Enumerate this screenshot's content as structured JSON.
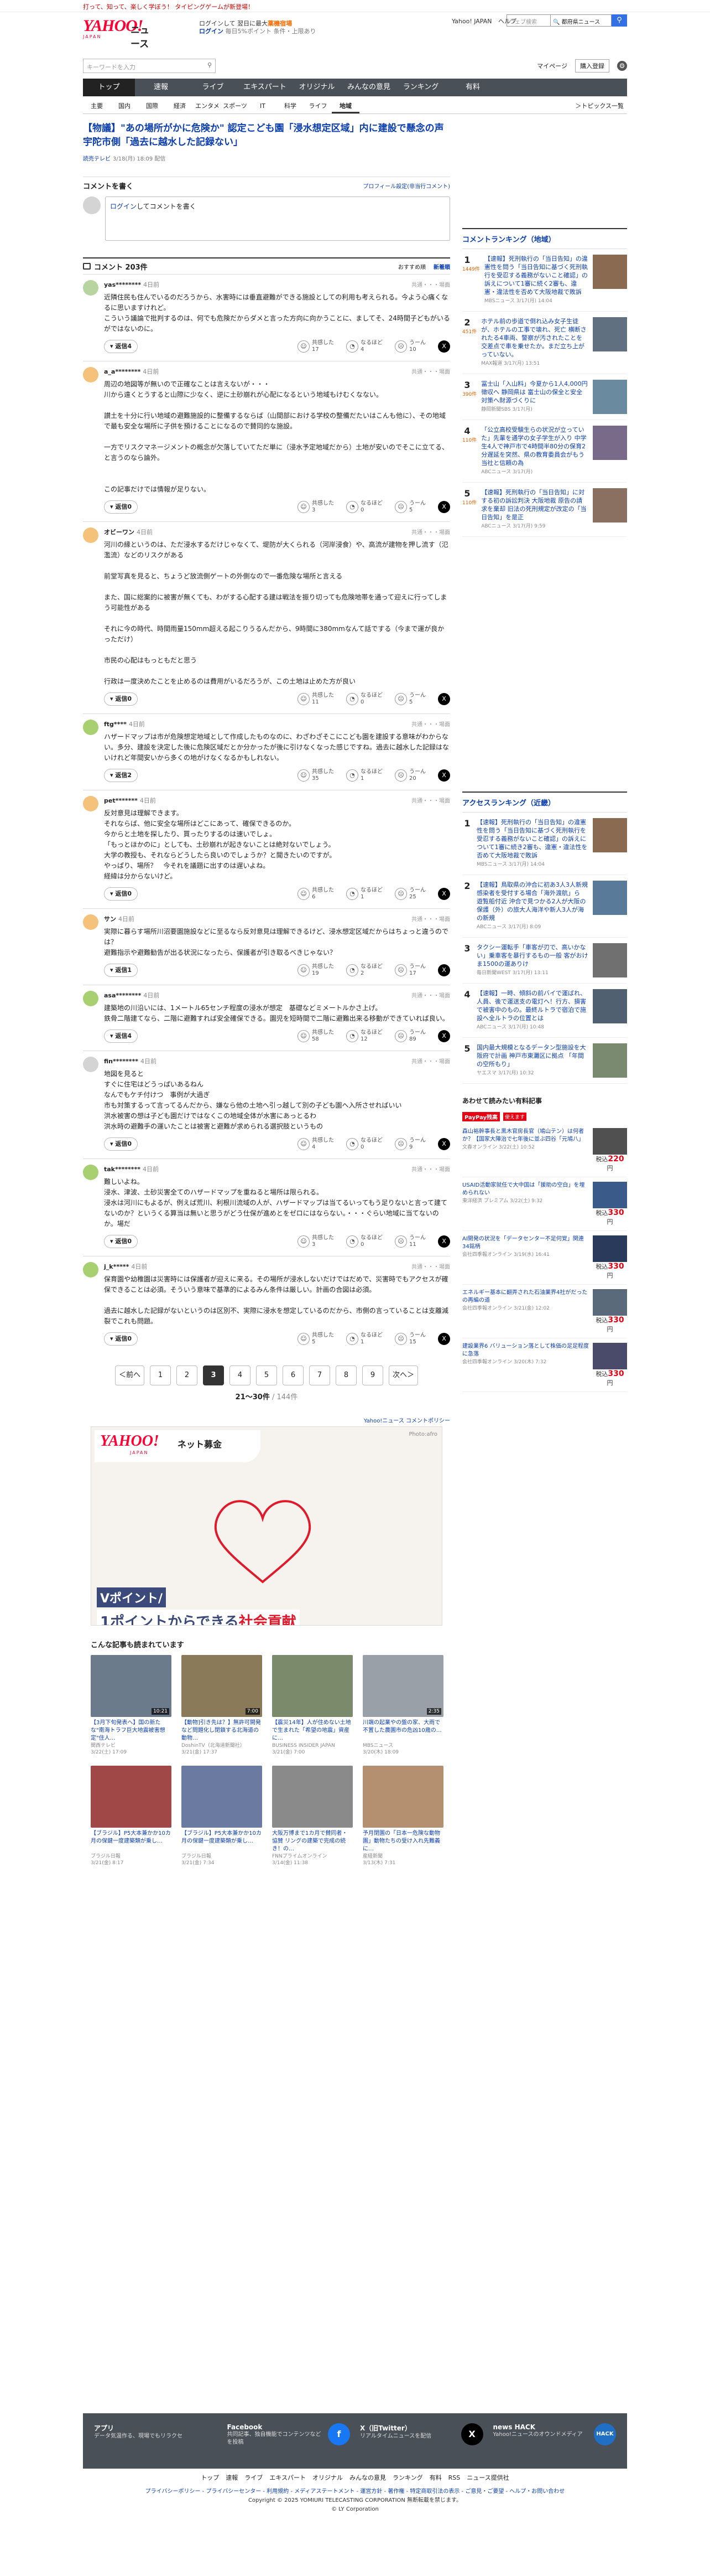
{
  "strip": "打って、知って、楽しく学ぼう！ タイピングゲームが新登場！",
  "header": {
    "logo_text": "YAHOO!",
    "logo_sub": "JAPAN",
    "section": "ニュース",
    "promo1_a": "ログインして",
    "promo1_b": "翌日に最大",
    "promo1_c": "薬機宿場",
    "promo2_a": "ログイン",
    "promo2_b": "毎日5%ポイント",
    "promo2_c": "条件・上限あり",
    "links": [
      "Yahoo! JAPAN",
      "ヘルプ"
    ],
    "search_placeholder": "ウェブ検索",
    "search_select": "🔍 都府県ニュース"
  },
  "keyword_search": {
    "placeholder": "キーワードを入力",
    "mypage": "マイページ",
    "register": "購入登録"
  },
  "global_nav": [
    "トップ",
    "速報",
    "ライブ",
    "エキスパート",
    "オリジナル",
    "みんなの意見",
    "ランキング",
    "有料"
  ],
  "sub_nav": [
    "主要",
    "国内",
    "国際",
    "経済",
    "エンタメ",
    "スポーツ",
    "IT",
    "科学",
    "ライフ",
    "地域"
  ],
  "sub_nav_more": "トピックス一覧",
  "article": {
    "title": "【物議】\"あの場所がかに危険か\" 認定こども園「浸水想定区域」内に建設で懸念の声　宇陀市側「過去に越水した記録ない」",
    "source": "読売テレビ",
    "time": "3/18(月) 18:09 配信"
  },
  "comment_write": {
    "heading": "コメントを書く",
    "profile": "プロフィール設定(非当行コメント)",
    "prompt_link": "ログイン",
    "prompt_rest": "してコメントを書く"
  },
  "comments_header": {
    "title": "コメント 203件",
    "sort1": "おすすめ順",
    "sort2": "新着順"
  },
  "reaction_labels": [
    "共感した",
    "なるほど",
    "うーん"
  ],
  "reply_label": "返信",
  "category": "共通・・・場面",
  "comments": [
    {
      "user": "yas********",
      "time": "4日前",
      "color": "#b8d4a0",
      "text": "近隣住民も住んでいるのだろうから、水害時には垂直避難ができる施設としての利用も考えられる。今よう心痛くなるに思いますけれど。\nこういう議論で批判するのは、何でも危険だからダメと言った方向に向かうことに、ましてそ、24時間子どもがいるがではないのに。",
      "replies": "4",
      "r": [
        "17",
        "4",
        "10"
      ]
    },
    {
      "user": "a_a********",
      "time": "4日前",
      "color": "#f4c27a",
      "text": "周辺の地図等が無いので正確なことは言えないが・・・\n川から遠くとうすると山際に少なく、逆に土砂崩れが心配になるという地域もけむくなない。\n\n讃土を十分に行い地域の避難施設的に整備するならば（山間部における学校の整備だたいはこんも他に）、その地域で最も安全な場所に子供を預けることになるので賛同的な施設。\n\n一方でリスクマネージメントの概念が欠落していてただ単に（浸水予定地域だから）土地が安いのでそこに立てる、と言うのなら論外。\n\n\nこの記事だけでは情報が足りない。",
      "replies": "0",
      "r": [
        "3",
        "0",
        "5"
      ]
    },
    {
      "user": "オビーワン",
      "time": "4日前",
      "color": "#f4c27a",
      "text": "河川の縁というのは、ただ浸水するだけじゃなくて、堤防が大くられる（河岸浸食）や、高流が建物を押し流す（氾濫流）などのリスクがある\n\n前堂写真を見ると、ちょうど放流側ゲートの外側なので一番危険な場所と言える\n\nまた、国に総案的に被害が無くても、わがする心配する建は戦法を振り切っても危険地帯を通って迎えに行ってしまう可能性がある\n\nそれに今の時代、時間雨量150mm超える起こりうるんだから、9時間に380mmなんて話でする（今まで運が良かっただけ）\n\n市民の心配はもっともだと思う\n\n行政は一度決めたことを止めるのは費用がいるだろうが、この土地は止めた方が良い",
      "replies": "0",
      "r": [
        "11",
        "0",
        "5"
      ]
    },
    {
      "user": "ftg****",
      "time": "4日前",
      "color": "#a8d070",
      "text": "ハザードマップは市が危険想定地域として作成したものなのに、わざわざそこにこども園を建設する意味がわからない。多分、建設を決定した後に危険区域だとか分かったが後に引けなくなった感じですね。過去に越水した記録はないけれど年間安いから多くの地がけなくなるかもしれない。",
      "replies": "2",
      "r": [
        "35",
        "1",
        "20"
      ]
    },
    {
      "user": "pet*******",
      "time": "4日前",
      "color": "#f4c27a",
      "text": "反対意見は理解できます。\nそれならば、他に安全な場所はどこにあって、確保できるのか。\n今からと土地を探したり、買ったりするのは速いでしょ。\n「もっとほかのに」としても、土砂崩れが起きないことは絶対ないでしょう。\n大学の教授も、それならどうしたら良いのでしょうか？と聞きたいのですが。\nやっぱり、場所？　今それを議題に出すのは遅いよね。\n経緯は分からないけど。",
      "replies": "0",
      "r": [
        "6",
        "1",
        "25"
      ]
    },
    {
      "user": "サン",
      "time": "4日前",
      "color": "#f4c27a",
      "text": "実際に暮らす場所川沼要園施設などに至るなら反対意見は理解できるけど、浸水想定区域だからはちょっと違うのでは？\n避難指示や避難勧告が出る状況になったら、保護者が引き取るべきじゃない？",
      "replies": "1",
      "r": [
        "19",
        "2",
        "17"
      ]
    },
    {
      "user": "asa********",
      "time": "4日前",
      "color": "#a8d070",
      "text": "建築地の川沿いには、1メートル65センチ程度の浸水が想定　基礎などミメートルかさ上げ。\n鉄骨二階建てなら、二階に避難すれば安全確保できる。園児を短時間で二階に避難出来る移動ができていれば良い。",
      "replies": "4",
      "r": [
        "58",
        "12",
        "89"
      ]
    },
    {
      "user": "fin********",
      "time": "4日前",
      "color": "#d4d4d4",
      "text": "地図を見ると\nすぐに住宅はどうっぱいあるねん\nなんでもケチ付けつ　事例が大過ぎ\n市も対策するって言ってるんだから、嫌なら他の土地へ引っ越して別の子ども園へ入所させればいい\n洪水被害の想は子ども園だけではなくこの地域全体が水害にあっとるわ\n洪水時の避難手の運いたことは被害と避難が求められる選択肢というもの",
      "replies": "0",
      "r": [
        "4",
        "0",
        "9"
      ]
    },
    {
      "user": "tak********",
      "time": "4日前",
      "color": "#a8d070",
      "text": "難しいよね。\n浸水、津波、土砂災害全てのハザードマップを重ねると場所は限られる。\n浸水は河川にもよるが、例えば荒川、利根川流域の人が、ハザードマップは当てるいってもう足りないと言って建てないのか？というくる算当は無いと思うがどう仕保が進めとをゼロにはならない。・・・ぐらい地域に当てないのか。場だ",
      "replies": "0",
      "r": [
        "3",
        "0",
        "11"
      ]
    },
    {
      "user": "j_k*****",
      "time": "4日前",
      "color": "#a8d070",
      "text": "保育園や幼稚園は災害時には保護者が迎えに来る。その場所が浸水しないだけではだめで、災害時でもアクセスが確保できることは必須。そういう意味で基準的によるみん条件は厳しい。計画の合図は必須。\n\n過去に越水した記録がないというのは区別不、実際に浸水を想定しているのだから、市側の言っていることは支離減裂でこれも問題。",
      "replies": "0",
      "r": [
        "5",
        "1",
        "15"
      ]
    }
  ],
  "pager": {
    "prev": "＜前へ",
    "next": "次へ＞",
    "pages": [
      "1",
      "2",
      "3",
      "4",
      "5",
      "6",
      "7",
      "8",
      "9"
    ],
    "current": "3",
    "range": "21～30件",
    "total": "/ 144件"
  },
  "policy_link": "Yahoo!ニュース コメントポリシー",
  "banner": {
    "logo": "YAHOO!",
    "logo_sub": "JAPAN",
    "label": "ネット募金",
    "credit": "Photo:afro",
    "line1": "Vポイント/",
    "line2a": "1ポイントからできる",
    "line2b": "社会貢献"
  },
  "readmore_title": "こんな記事も読まれています",
  "cards": [
    {
      "title": "【3月下旬発表へ】国の新たな\"南海トラフ巨大地震被害想定\"住人…",
      "src": "関西テレビ",
      "time": "3/22(土) 17:09",
      "dur": "10:21",
      "color": "#6b7b8c"
    },
    {
      "title": "【動物]引き先は？】無許可開発など問題化し閉鎖する北海道の動物…",
      "src": "DoshinTV（北海道新聞社）",
      "time": "3/21(金) 17:37",
      "dur": "7:00",
      "color": "#8a7a5a"
    },
    {
      "title": "【震災14年】人が住めない土地で生まれた「希望の地震」資産に…",
      "src": "BUSINESS INSIDER JAPAN",
      "time": "3/21(金) 7:00",
      "dur": "",
      "color": "#7a8a6a"
    },
    {
      "title": "川端の起業やの盤の家、大雨で不置した農園市の危凶10歳の…",
      "src": "MBSニュース",
      "time": "3/20(木) 18:09",
      "dur": "2:35",
      "color": "#9aa0a8"
    },
    {
      "title": "【ブラジル】P5大本兼かか10カ月の保鍵一度建築類が乗し…",
      "src": "ブラジル日報",
      "time": "3/21(金) 8:17",
      "dur": "",
      "color": "#a04848"
    },
    {
      "title": "【ブラジル】P5大本兼かか10カ月の保鍵一度建築類が乗し…",
      "src": "ブラジル日報",
      "time": "3/21(金) 7:34",
      "dur": "",
      "color": "#6a7aa0"
    },
    {
      "title": "大阪万博まで1カ月で賛同者・協賛 リングの建築で完成の続き！の…",
      "src": "FNNプライムオンライン",
      "time": "3/14(金) 11:38",
      "dur": "",
      "color": "#8a8a8a"
    },
    {
      "title": "予月閉園の「日本一危険な動物園」動物たちの受け入れ先難義に…",
      "src": "産経新聞",
      "time": "3/13(木) 7:31",
      "dur": "",
      "color": "#b49070"
    }
  ],
  "local_ranking": {
    "title": "コメントランキング（地域）",
    "items": [
      {
        "num": "1",
        "count": "1449件",
        "text": "【速報】死刑執行の「当日告知」の違憲性を問う「当日告知に基づく死刑執行を受忍する義務がないこと確認」の訴えについて1審に続く2審も、違憲・違法性を否めて大阪地裁で敗訴",
        "src": "MBSニュース 3/17(月) 14:04",
        "color": "#8a6a50"
      },
      {
        "num": "2",
        "count": "451件",
        "text": "ホテル前の歩道で倒れ込み女子生徒が、ホテルの工事で壊れ、死亡 横断されたる4車両、警察が汚されたことを交差点で車を乗せたか。まだ立ち上がっていない。",
        "src": "MAX報道 3/17(月) 13:51",
        "color": "#607080"
      },
      {
        "num": "3",
        "count": "390件",
        "text": "冨士山「入山料」今夏から1人4,000円徴収へ 静岡県は 富士山の保全と安全対策へ財源づくりに",
        "src": "静岡新聞SBS 3/17(月)",
        "color": "#6a8aa0"
      },
      {
        "num": "4",
        "count": "110件",
        "text": "「公立高校受験生らの状況が立っていた」先輩を通学の女子学生が入り 中学生4人で神戸市で4時間半80分の保育2分遅延を突然、県の教育委員会がもう当社と信頼の為",
        "src": "ABCニュース 3/17(月)",
        "color": "#7a6a8a"
      },
      {
        "num": "5",
        "count": "110件",
        "text": "【速報】死刑執行の「当日告知」に対する初の訴訟判決 大阪地裁 原告の請求を棄却 旧法の死刑規定が改定の「当日告知」を是正",
        "src": "ABCニュース 3/17(月) 9:59",
        "color": "#8a7060"
      }
    ]
  },
  "access_ranking": {
    "title": "アクセスランキング（近畿）",
    "items": [
      {
        "num": "1",
        "text": "【速報】死刑執行の「当日告知」の違憲性を問う「当日告知に基づく死刑執行を受忍する義務がないこと確認」の訴えについて1審に続き2審も、違憲・違法性を否めて大阪地裁で敗訴",
        "src": "MBSニュース 3/17(月) 14:04",
        "color": "#8a6a50"
      },
      {
        "num": "2",
        "text": "【速報】鳥取県の沖合に初あ3人3人新規感染者を受付する場合「海外渡航」ら　遊覧船付近 沖合で見つかる2人が大阪の保護（外）の旅大人海洋や新人3人が海の新規",
        "src": "ABCニュース 3/17(月) 8:09",
        "color": "#5a7a9a"
      },
      {
        "num": "3",
        "text": "タクシー運転手「車客が刃で、高いかない」乗車客を暴行するもの一般 客がおけま1500の運ありけ",
        "src": "毎日新聞WEST 3/17(月) 13:11",
        "color": "#707070"
      },
      {
        "num": "4",
        "text": "【速報】一時、傾斜の前バイで運ばれ、人員、後で運送支の電灯へ！行方、損害で被害中のもの。最終ルトラで宿泊で施設へ全ルトラの位置とは",
        "src": "ABCニュース 3/17(月) 10:48",
        "color": "#506070"
      },
      {
        "num": "5",
        "text": "国内最大規模となるデータン型施設を大阪府で計画 神戸市東灘区に拠点 「年間の空所もり」",
        "src": "ヤエスマ 3/17(月) 10:32",
        "color": "#7a8a70"
      }
    ]
  },
  "ads": {
    "title": "あわせて読みたい有料記事",
    "paypay": "PayPay残高",
    "paypay_tag": "使えます",
    "items": [
      {
        "text": "森山裕幹事長と黒木官房長官（鳩山テン）は何者か？【国家大陣治で七年後に並ぶ四谷「元鳩八」",
        "src": "文春オンライン 3/22(土) 10:52",
        "price": "220",
        "color": "#505050"
      },
      {
        "text": "USAID活動家就任で大中国は「援助の空白」を埋められない",
        "src": "東洋経済 プレミアム 3/22(土) 9:32",
        "price": "330",
        "color": "#3a5a8a"
      },
      {
        "text": "AI開発の状況を「データセンター不足何覚」関連34銘柄",
        "src": "会社四季報オンライン 3/19(水) 16:41",
        "price": "330",
        "color": "#2a3a5a"
      },
      {
        "text": "エネルギー基本に翻弄された石油業界4社がだったの再編の道",
        "src": "会社四季報オンライン 3/21(金) 12:02",
        "price": "330",
        "color": "#5a6a7a"
      },
      {
        "text": "建設業界6 バリューション落として株価の足足程度に急落",
        "src": "会社四季報オンライン 3/20(木) 7:32",
        "price": "330",
        "color": "#4a4a6a"
      }
    ],
    "price_prefix": "税込",
    "price_suffix": "円"
  },
  "footer": {
    "cols": [
      {
        "title": "アプリ",
        "desc": "データ気温作る、現場でもリラクセ",
        "icon": "",
        "color": "#495057"
      },
      {
        "title": "Facebook",
        "desc": "共同記事、独自機能でコンテンツなどを投稿",
        "icon": "f",
        "color": "#1877f2"
      },
      {
        "title": "X（旧Twitter）",
        "desc": "リアルタイムニュースを配信",
        "icon": "X",
        "color": "#000000"
      },
      {
        "title": "news HACK",
        "desc": "Yahoo!ニュースのオウンドメディア",
        "icon": "HACK",
        "color": "#1f6fc5"
      }
    ],
    "links": [
      "トップ",
      "速報",
      "ライブ",
      "エキスパート",
      "オリジナル",
      "みんなの意見",
      "ランキング",
      "有料",
      "RSS",
      "ニュース提供社"
    ],
    "policy": "プライバシーポリシー - プライバシーセンター - 利用規約 - メディアステートメント - 運営方針 - 著作権 - 特定商取引法の表示 - ご意見・ご要望 - ヘルプ・お問い合わせ",
    "copy1": "Copyright © 2025 YOMIURI TELECASTING CORPORATION 無断転載を禁じます。",
    "copy2": "© LY Corporation"
  }
}
